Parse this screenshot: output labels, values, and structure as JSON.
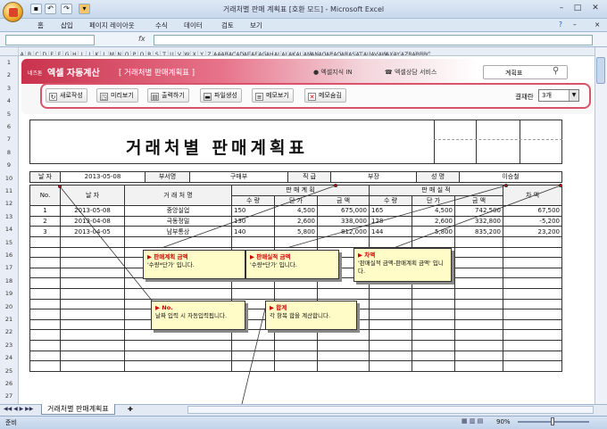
{
  "window": {
    "title": "거래처별 판매 계획표  [호환 모드] - Microsoft Excel"
  },
  "ribbon": {
    "tabs": [
      "홈",
      "삽입",
      "페이지 레이아웃",
      "수식",
      "데이터",
      "검토",
      "보기"
    ]
  },
  "formula_bar": {
    "fx": "fx",
    "name_box": "",
    "content": ""
  },
  "columns": [
    "A",
    "B",
    "C",
    "D",
    "E",
    "F",
    "G",
    "H",
    "I",
    "J",
    "K",
    "L",
    "M",
    "N",
    "O",
    "P",
    "Q",
    "R",
    "S",
    "T",
    "U",
    "V",
    "W",
    "X",
    "Y",
    "Z",
    "AA",
    "AB",
    "AC",
    "AD",
    "AE",
    "AF",
    "AG",
    "AH",
    "AI",
    "AJ",
    "AK",
    "AL",
    "AM",
    "AN",
    "AO",
    "AP",
    "AQ",
    "AR",
    "AS",
    "AT",
    "AU",
    "AV",
    "AW",
    "AX",
    "AY",
    "AZ",
    "BA",
    "BB",
    "BC"
  ],
  "rows": [
    "1",
    "2",
    "3",
    "4",
    "5",
    "6",
    "7",
    "8",
    "9",
    "10",
    "11",
    "12",
    "13",
    "14",
    "15",
    "16",
    "17",
    "18",
    "19",
    "20",
    "21",
    "22",
    "23",
    "24",
    "25",
    "26",
    "27"
  ],
  "banner": {
    "brand_small": "네즈톤",
    "brand": "엑셀 자동계산",
    "title": "[ 거래처별 판매계획표 ]",
    "nav_1": "엑셀지식 IN",
    "nav_2": "엑셀상담 서비스",
    "search_label": "계획표"
  },
  "toolbar": {
    "new": "새로작성",
    "preview": "미리보기",
    "print": "출력하기",
    "file": "파일생성",
    "memo_show": "메모보기",
    "memo_hide": "메모숨김",
    "approval_label": "결재란",
    "approval_value": "3개"
  },
  "document": {
    "title": "거래처별 판매계획표",
    "info": {
      "date_label": "날 자",
      "date": "2013-05-08",
      "dept_label": "부서명",
      "dept": "구매부",
      "rank_label": "직 급",
      "rank": "부장",
      "name_label": "성 명",
      "name": "이승철"
    },
    "headers": {
      "no": "No.",
      "date": "날 자",
      "client": "거 래 처 명",
      "plan": "판 매 계 획",
      "actual": "판 매 실 적",
      "diff": "차 액",
      "qty": "수 량",
      "price": "단 가",
      "amount": "금 액"
    },
    "rows": [
      {
        "no": "1",
        "date": "2013-05-08",
        "client": "중앙실업",
        "plan_qty": "150",
        "plan_price": "4,500",
        "plan_amount": "675,000",
        "act_qty": "165",
        "act_price": "4,500",
        "act_amount": "742,500",
        "diff": "67,500"
      },
      {
        "no": "2",
        "date": "2013-04-08",
        "client": "극동정밀",
        "plan_qty": "130",
        "plan_price": "2,600",
        "plan_amount": "338,000",
        "act_qty": "128",
        "act_price": "2,600",
        "act_amount": "332,800",
        "diff": "-5,200"
      },
      {
        "no": "3",
        "date": "2013-04-05",
        "client": "남부통상",
        "plan_qty": "140",
        "plan_price": "5,800",
        "plan_amount": "812,000",
        "act_qty": "144",
        "act_price": "5,800",
        "act_amount": "835,200",
        "diff": "23,200"
      }
    ]
  },
  "callouts": {
    "plan": {
      "head": "▶ 판매계획 금액",
      "body": "'수량*단가' 입니다."
    },
    "actual": {
      "head": "▶ 판매실적 금액",
      "body": "'수량*단가' 입니다."
    },
    "diff": {
      "head": "▶ 차액",
      "body": "'판매실적 금액-판매계획 금액' 입니다."
    },
    "no": {
      "head": "▶ No.",
      "body": "날짜 입력 시 자동입력됩니다."
    },
    "total": {
      "head": "▶ 합계",
      "body": "각 항목 합을 계산합니다."
    }
  },
  "sheet_tab": "거래처별 판매계획표",
  "status": {
    "text": "준비",
    "zoom": "90%"
  },
  "colors": {
    "accent": "#c9324c",
    "callout": "#fffcc8"
  }
}
